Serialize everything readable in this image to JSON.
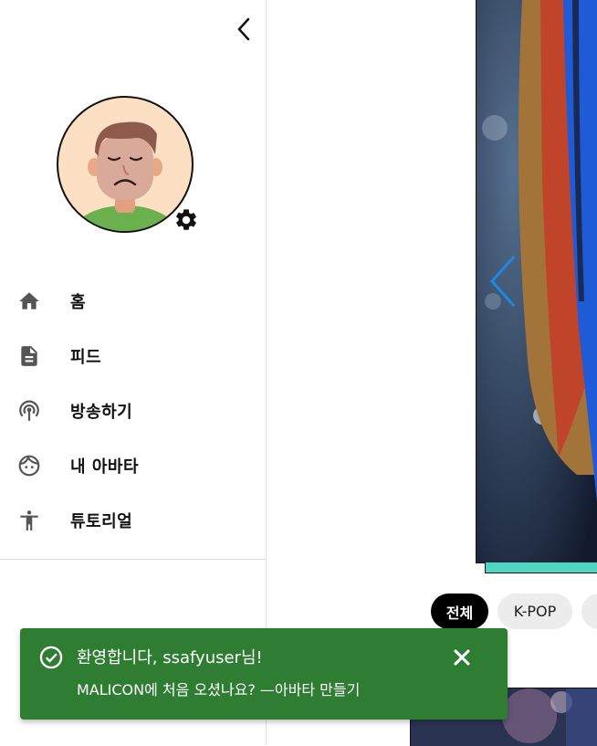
{
  "sidebar": {
    "collapse_icon": "chevron-left-icon",
    "avatar": {
      "icon": "avatar-face",
      "settings_icon": "gear-icon"
    },
    "items": [
      {
        "label": "홈",
        "icon": "home-icon"
      },
      {
        "label": "피드",
        "icon": "article-icon"
      },
      {
        "label": "방송하기",
        "icon": "broadcast-icon"
      },
      {
        "label": "내 아바타",
        "icon": "face-icon"
      },
      {
        "label": "튜토리얼",
        "icon": "accessibility-icon"
      }
    ]
  },
  "main": {
    "banner": {
      "prev_icon": "chevron-left-icon",
      "accent_color": "#4fd6c2"
    },
    "chips": [
      {
        "label": "전체",
        "active": true
      },
      {
        "label": "K-POP",
        "active": false
      }
    ]
  },
  "toast": {
    "title": "환영합니다, ssafyuser님!",
    "message": "MALICON에 처음 오셨나요? —아바타 만들기",
    "icon": "check-circle-icon",
    "close_icon": "close-icon",
    "color": "#2e7d32"
  }
}
